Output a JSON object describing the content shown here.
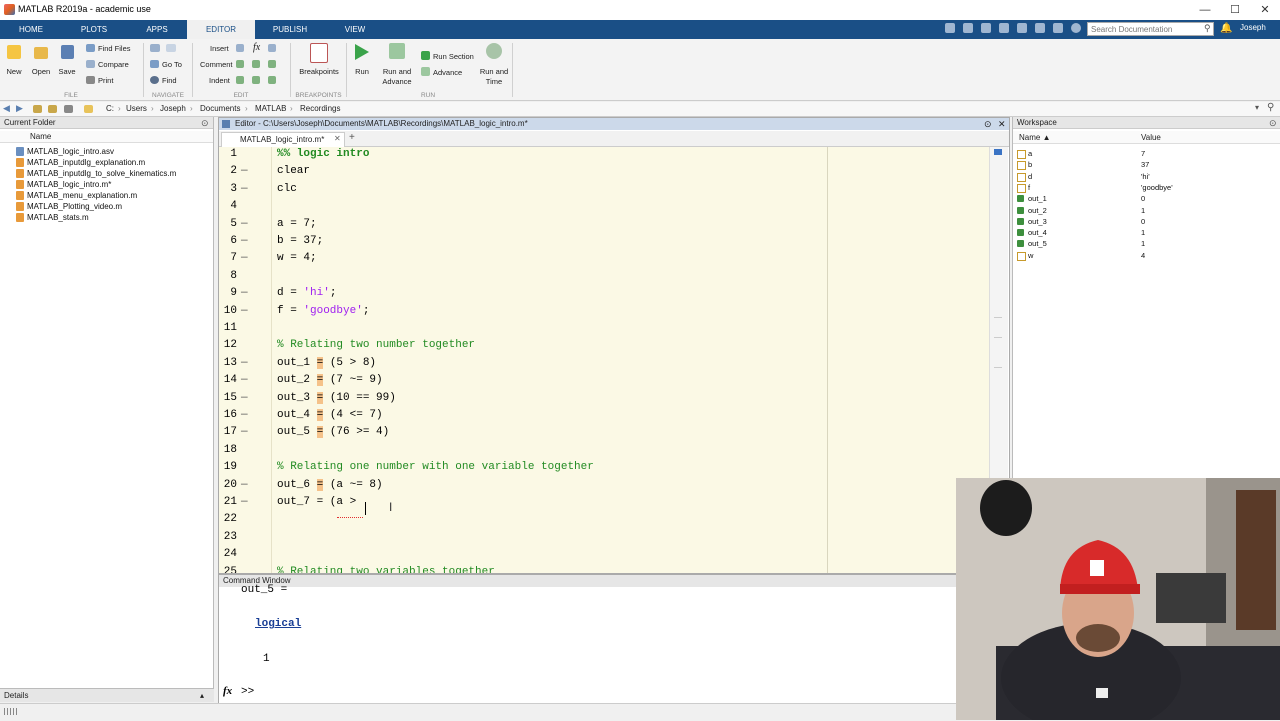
{
  "window": {
    "title": "MATLAB R2019a - academic use",
    "minimize": "—",
    "maximize": "☐",
    "close": "✕"
  },
  "tabs": [
    "HOME",
    "PLOTS",
    "APPS",
    "EDITOR",
    "PUBLISH",
    "VIEW"
  ],
  "search_placeholder": "Search Documentation",
  "user": "Joseph",
  "toolstrip": {
    "file": {
      "new": "New",
      "open": "Open",
      "save": "Save",
      "find_files": "Find Files",
      "compare": "Compare",
      "print": "Print",
      "label": "FILE"
    },
    "navigate": {
      "go_to": "Go To",
      "find": "Find",
      "label": "NAVIGATE"
    },
    "edit": {
      "insert": "Insert",
      "comment": "Comment",
      "indent": "Indent",
      "fx": "fx",
      "label": "EDIT"
    },
    "breakpoints": {
      "breakpoints": "Breakpoints",
      "label": "BREAKPOINTS"
    },
    "run": {
      "run": "Run",
      "run_and_advance": "Run and Advance",
      "run_section": "Run Section",
      "advance": "Advance",
      "run_and_time": "Run and Time",
      "label": "RUN"
    }
  },
  "address": [
    "C:",
    "Users",
    "Joseph",
    "Documents",
    "MATLAB",
    "Recordings"
  ],
  "current_folder": {
    "title": "Current Folder",
    "column": "Name",
    "files": [
      "MATLAB_logic_intro.asv",
      "MATLAB_inputdlg_explanation.m",
      "MATLAB_inputdlg_to_solve_kinematics.m",
      "MATLAB_logic_intro.m*",
      "MATLAB_menu_explanation.m",
      "MATLAB_Plotting_video.m",
      "MATLAB_stats.m"
    ]
  },
  "details_label": "Details",
  "editor": {
    "title": "Editor - C:\\Users\\Joseph\\Documents\\MATLAB\\Recordings\\MATLAB_logic_intro.m*",
    "tab": "MATLAB_logic_intro.m*",
    "lines": [
      {
        "n": "1",
        "dash": "",
        "text": "%% logic intro",
        "kind": "cell"
      },
      {
        "n": "2",
        "dash": "—",
        "text": "clear",
        "kind": "code"
      },
      {
        "n": "3",
        "dash": "—",
        "text": "clc",
        "kind": "code"
      },
      {
        "n": "4",
        "dash": "",
        "text": "",
        "kind": "code"
      },
      {
        "n": "5",
        "dash": "—",
        "text": "a = 7;",
        "kind": "code"
      },
      {
        "n": "6",
        "dash": "—",
        "text": "b = 37;",
        "kind": "code"
      },
      {
        "n": "7",
        "dash": "—",
        "text": "w = 4;",
        "kind": "code"
      },
      {
        "n": "8",
        "dash": "",
        "text": "",
        "kind": "code"
      },
      {
        "n": "9",
        "dash": "—",
        "pre": "d = ",
        "str": "'hi'",
        "post": ";",
        "kind": "string"
      },
      {
        "n": "10",
        "dash": "—",
        "pre": "f = ",
        "str": "'goodbye'",
        "post": ";",
        "kind": "string"
      },
      {
        "n": "11",
        "dash": "",
        "text": "",
        "kind": "code"
      },
      {
        "n": "12",
        "dash": "",
        "text": "% Relating two number together",
        "kind": "comment"
      },
      {
        "n": "13",
        "dash": "—",
        "pre": "out_1 ",
        "hl": "=",
        "post": " (5 > 8)",
        "kind": "hl"
      },
      {
        "n": "14",
        "dash": "—",
        "pre": "out_2 ",
        "hl": "=",
        "post": " (7 ~= 9)",
        "kind": "hl"
      },
      {
        "n": "15",
        "dash": "—",
        "pre": "out_3 ",
        "hl": "=",
        "post": " (10 == 99)",
        "kind": "hl"
      },
      {
        "n": "16",
        "dash": "—",
        "pre": "out_4 ",
        "hl": "=",
        "post": " (4 <= 7)",
        "kind": "hl"
      },
      {
        "n": "17",
        "dash": "—",
        "pre": "out_5 ",
        "hl": "=",
        "post": " (76 >= 4)",
        "kind": "hl"
      },
      {
        "n": "18",
        "dash": "",
        "text": "",
        "kind": "code"
      },
      {
        "n": "19",
        "dash": "",
        "text": "% Relating one number with one variable together",
        "kind": "comment"
      },
      {
        "n": "20",
        "dash": "—",
        "pre": "out_6 ",
        "hl": "=",
        "post": " (a ~= 8)",
        "kind": "hl"
      },
      {
        "n": "21",
        "dash": "—",
        "text": "out_7 = (a >",
        "kind": "code"
      },
      {
        "n": "22",
        "dash": "",
        "text": "",
        "kind": "code"
      },
      {
        "n": "23",
        "dash": "",
        "text": "",
        "kind": "code"
      },
      {
        "n": "24",
        "dash": "",
        "text": "",
        "kind": "code"
      },
      {
        "n": "25",
        "dash": "",
        "text": "% Relating two variables together",
        "kind": "comment"
      }
    ]
  },
  "workspace": {
    "title": "Workspace",
    "col_name": "Name ▲",
    "col_value": "Value",
    "rows": [
      {
        "name": "a",
        "value": "7",
        "kind": "grid"
      },
      {
        "name": "b",
        "value": "37",
        "kind": "grid"
      },
      {
        "name": "d",
        "value": "'hi'",
        "kind": "grid"
      },
      {
        "name": "f",
        "value": "'goodbye'",
        "kind": "grid"
      },
      {
        "name": "out_1",
        "value": "0",
        "kind": "check"
      },
      {
        "name": "out_2",
        "value": "1",
        "kind": "check"
      },
      {
        "name": "out_3",
        "value": "0",
        "kind": "check"
      },
      {
        "name": "out_4",
        "value": "1",
        "kind": "check"
      },
      {
        "name": "out_5",
        "value": "1",
        "kind": "check"
      },
      {
        "name": "w",
        "value": "4",
        "kind": "grid"
      }
    ]
  },
  "command_window": {
    "title": "Command Window",
    "partial_line": "out_5 =",
    "type_word": "logical",
    "result": "1",
    "fx": "fx",
    "prompt": ">>"
  },
  "colors": {
    "tab_bg": "#1a4f86",
    "editor_bg": "#fbf9e5",
    "comment": "#228b22",
    "string": "#a020f0",
    "highlight": "#f5c28a"
  }
}
